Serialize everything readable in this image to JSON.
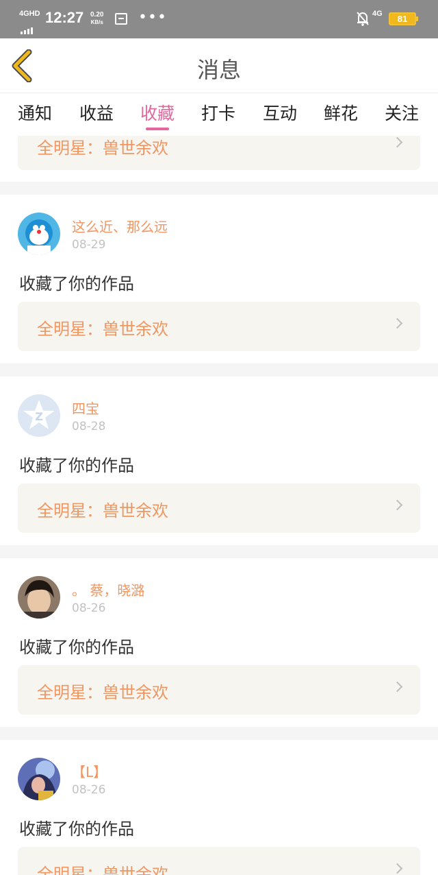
{
  "status_bar": {
    "network": "4GHD",
    "time": "12:27",
    "speed_value": "0.20",
    "speed_unit": "KB/s",
    "more": "•••",
    "network_right": "4G",
    "battery": "81"
  },
  "header": {
    "back_icon": "chevron-left-icon",
    "title": "消息"
  },
  "tabs": [
    {
      "label": "通知",
      "active": false
    },
    {
      "label": "收益",
      "active": false
    },
    {
      "label": "收藏",
      "active": true
    },
    {
      "label": "打卡",
      "active": false
    },
    {
      "label": "互动",
      "active": false
    },
    {
      "label": "鲜花",
      "active": false
    },
    {
      "label": "关注",
      "active": false
    }
  ],
  "feed": {
    "partial_top_work": "全明星：兽世余欢",
    "items": [
      {
        "user": "这么近、那么远",
        "date": "08-29",
        "action": "收藏了你的作品",
        "work": "全明星：兽世余欢"
      },
      {
        "user": "四宝",
        "date": "08-28",
        "action": "收藏了你的作品",
        "work": "全明星：兽世余欢"
      },
      {
        "user": "。 蔡，晓潞",
        "date": "08-26",
        "action": "收藏了你的作品",
        "work": "全明星：兽世余欢"
      },
      {
        "user": "【L】",
        "date": "08-26",
        "action": "收藏了你的作品",
        "work": "全明星：兽世余欢"
      }
    ]
  },
  "colors": {
    "accent": "#e3679e",
    "username": "#f19661",
    "work_bg": "#f6f5ef",
    "back_icon": "#f0b81c"
  }
}
